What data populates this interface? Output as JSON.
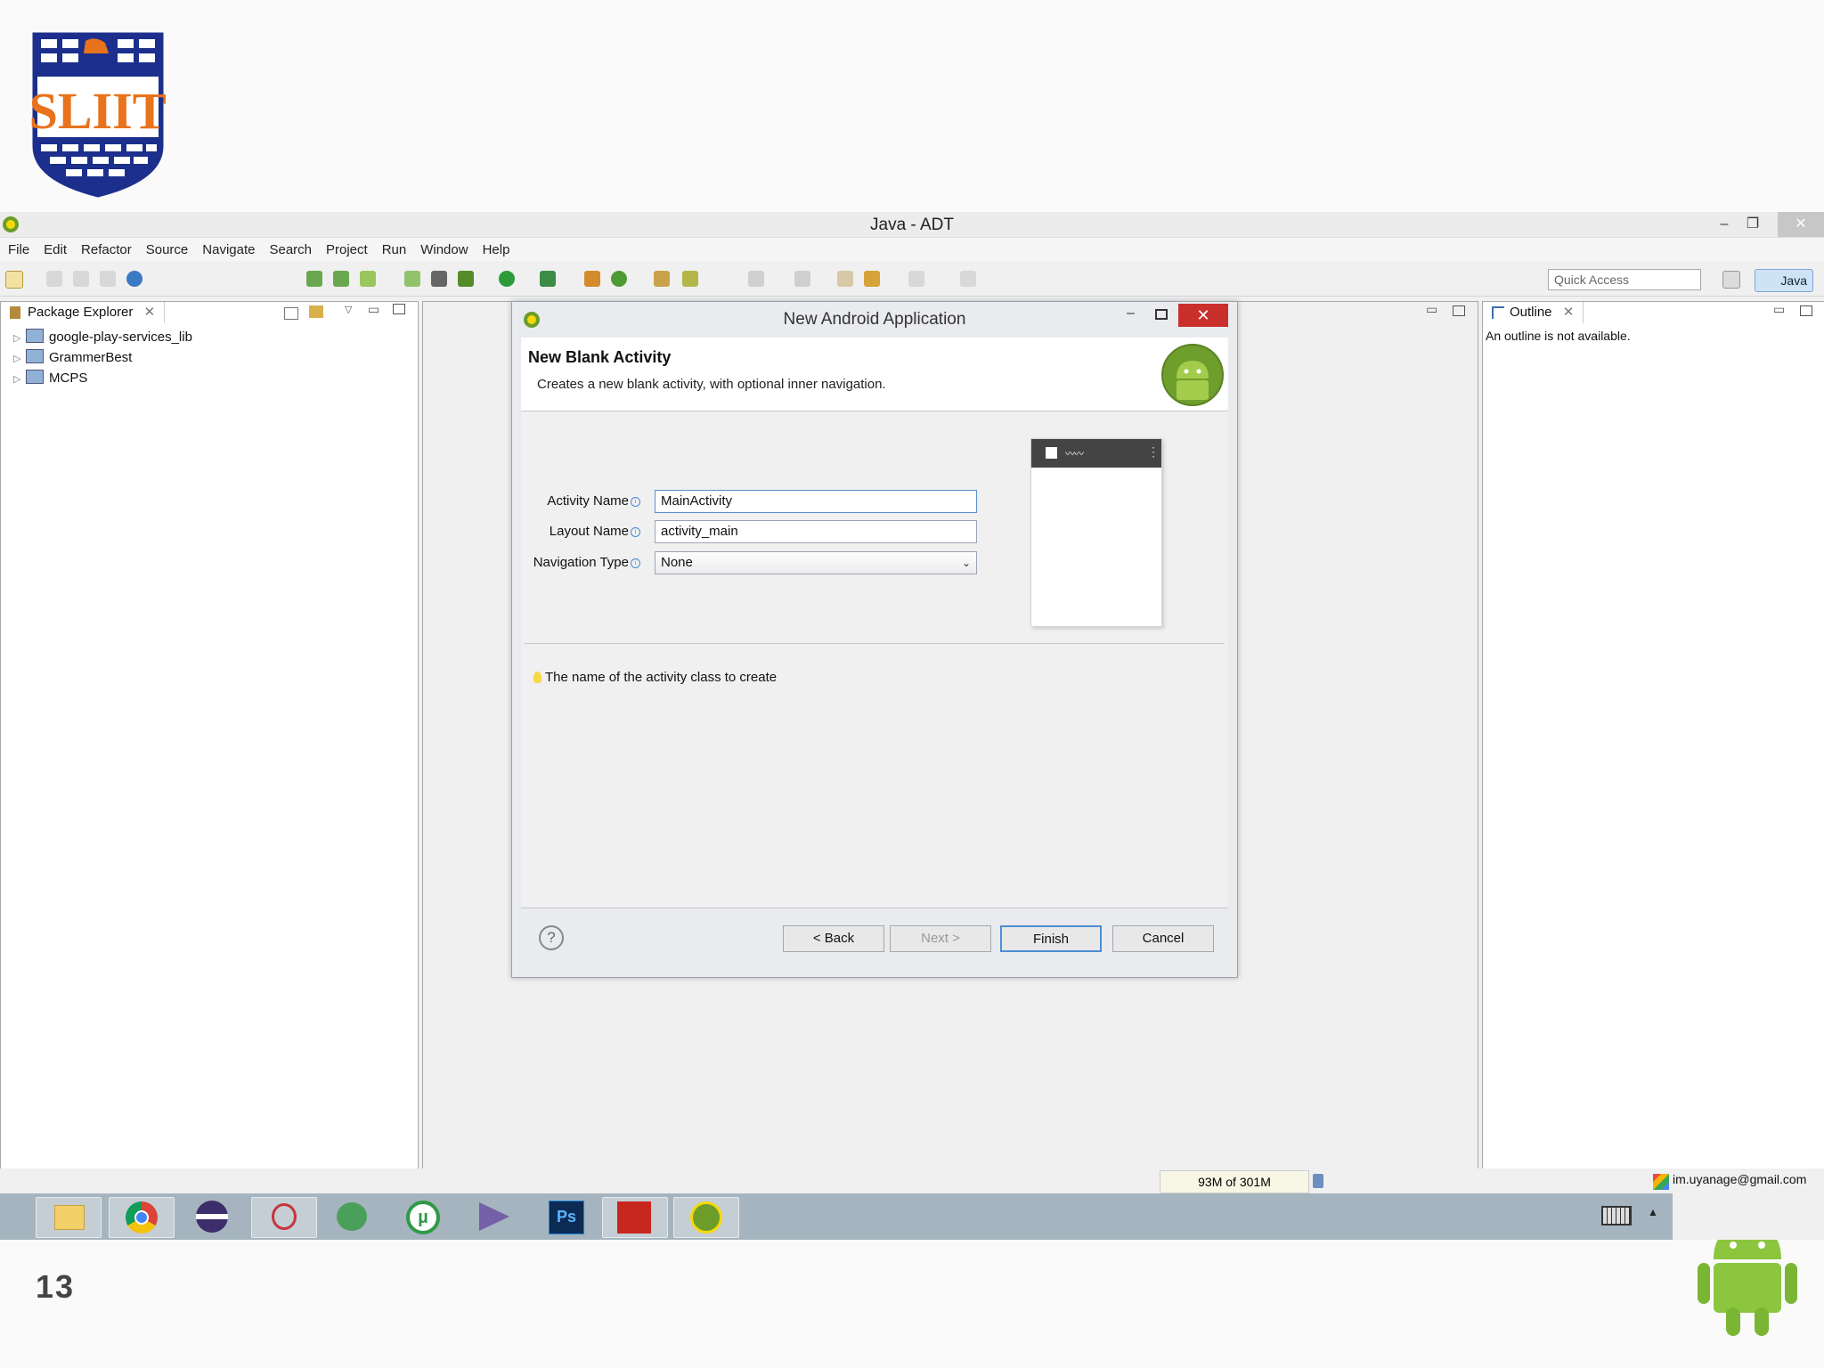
{
  "window": {
    "title": "Java - ADT",
    "controls": [
      "–",
      "❐",
      "✕"
    ]
  },
  "menu": [
    "File",
    "Edit",
    "Refactor",
    "Source",
    "Navigate",
    "Search",
    "Project",
    "Run",
    "Window",
    "Help"
  ],
  "toolbar": {
    "quick_access_placeholder": "Quick Access",
    "perspective": "Java"
  },
  "package_explorer": {
    "tab": "Package Explorer",
    "items": [
      "google-play-services_lib",
      "GrammerBest",
      "MCPS"
    ]
  },
  "outline": {
    "tab": "Outline",
    "message": "An outline is not available."
  },
  "dialog": {
    "title": "New Android Application",
    "heading": "New Blank Activity",
    "description": "Creates a new blank activity, with optional inner navigation.",
    "fields": {
      "activity_name_label": "Activity Name",
      "activity_name_value": "MainActivity",
      "layout_name_label": "Layout Name",
      "layout_name_value": "activity_main",
      "navigation_type_label": "Navigation Type",
      "navigation_type_value": "None"
    },
    "hint": "The name of the activity class to create",
    "buttons": {
      "back": "< Back",
      "next": "Next >",
      "finish": "Finish",
      "cancel": "Cancel",
      "help": "?"
    }
  },
  "status": {
    "heap": "93M of 301M",
    "user": "im.uyanage@gmail.com"
  },
  "slide": {
    "logo_text": "SLIIT",
    "page_number": "13"
  },
  "taskbar": {
    "apps": [
      "file-explorer",
      "chrome",
      "eclipse",
      "snipping-tool",
      "network",
      "utorrent",
      "visual-studio",
      "photoshop",
      "acrobat",
      "adt"
    ],
    "ps_label": "Ps"
  },
  "colors": {
    "close_red": "#c9302c",
    "accent_blue": "#4d8fd3",
    "taskbar": "#a5b4be",
    "logo_blue": "#1c2f8c",
    "logo_orange": "#e8731c"
  }
}
